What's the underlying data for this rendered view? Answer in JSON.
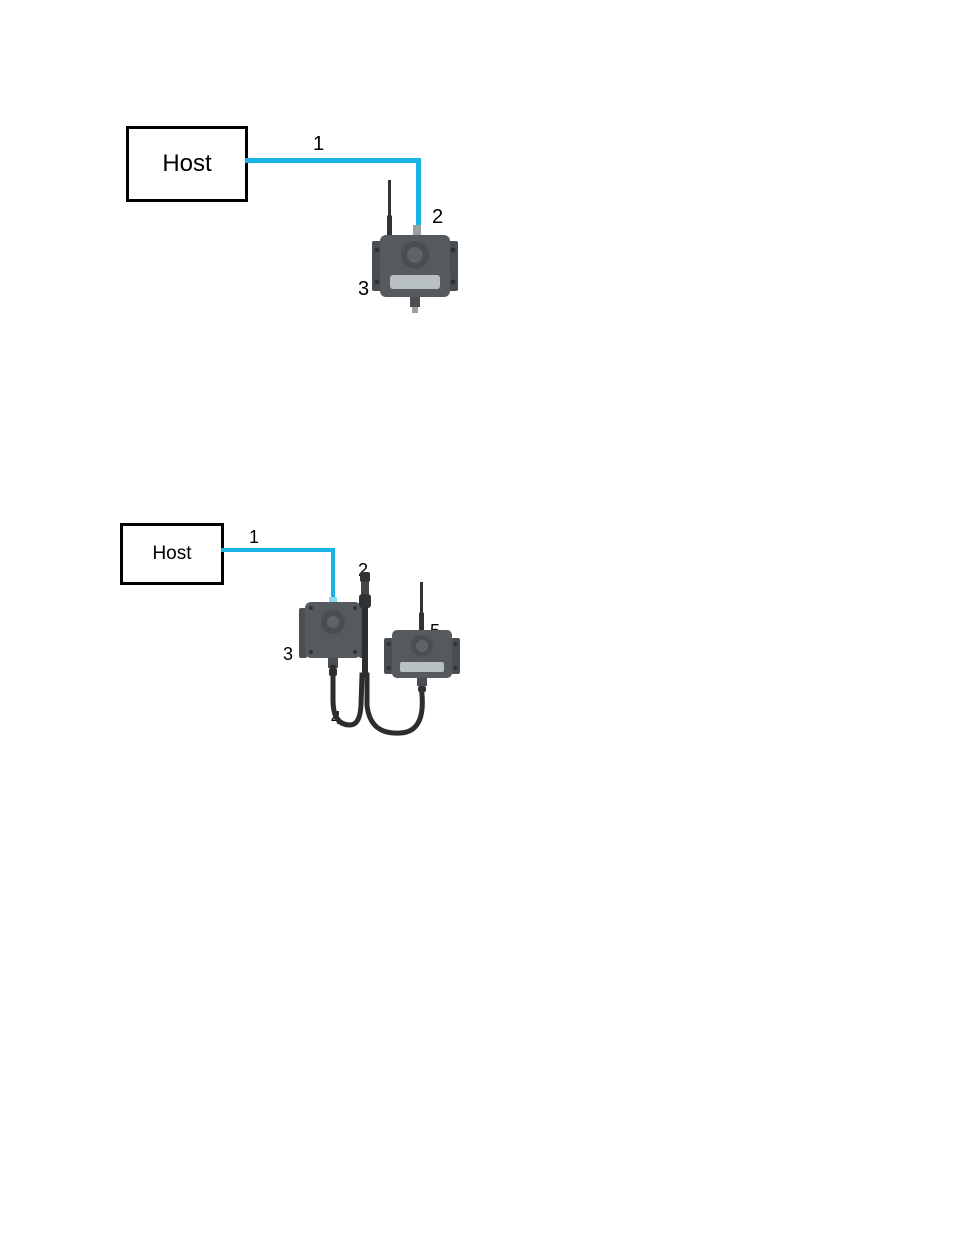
{
  "diagramA": {
    "host_label": "Host",
    "labels": {
      "l1": "1",
      "l2": "2",
      "l3": "3"
    }
  },
  "diagramB": {
    "host_label": "Host",
    "labels": {
      "l1": "1",
      "l2": "2",
      "l3": "3",
      "l4": "4",
      "l5": "5"
    }
  },
  "colors": {
    "cable_blue": "#19b3e6",
    "device_body": "#555a5e",
    "device_body_dark": "#4a4e52",
    "device_light_grey": "#9aa0a4",
    "device_screen": "#b9c0c4",
    "antenna": "#303336",
    "cable_black": "#2c2d2e"
  }
}
